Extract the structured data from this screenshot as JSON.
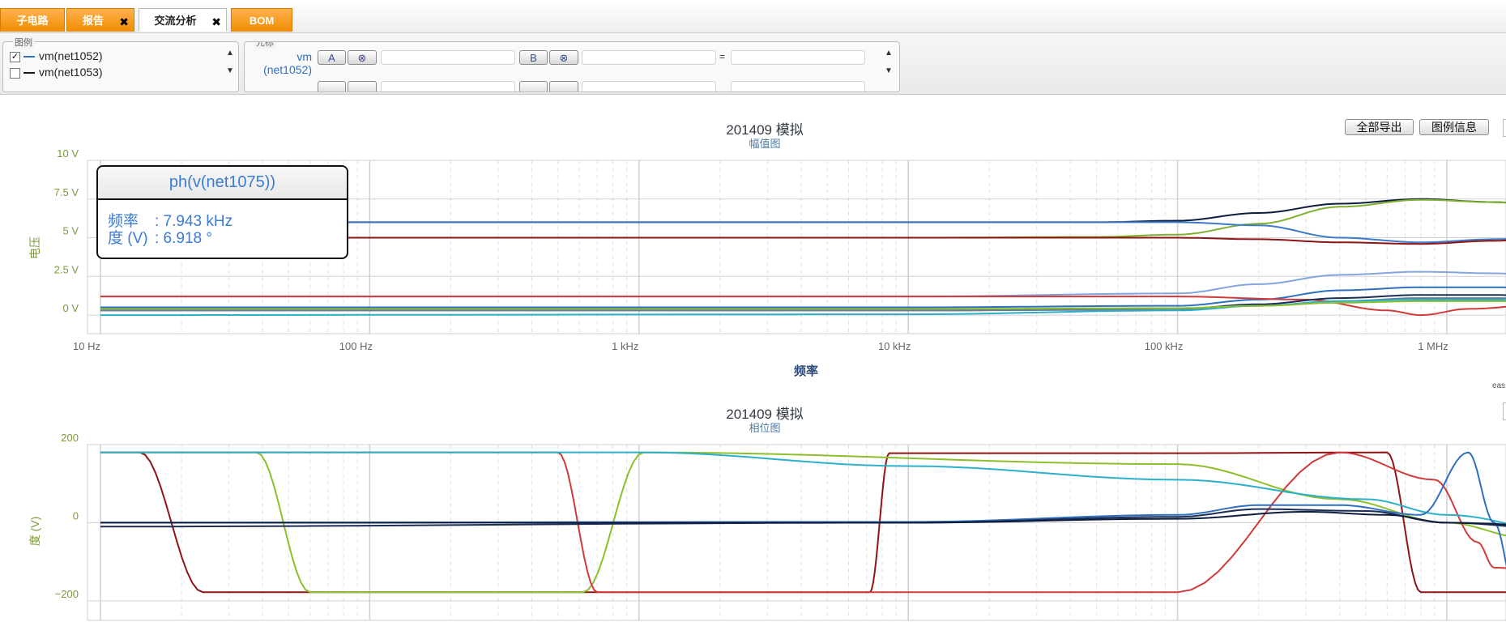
{
  "tabs": [
    {
      "label": "子电路",
      "closable": false
    },
    {
      "label": "报告",
      "closable": true
    },
    {
      "label": "交流分析",
      "closable": true
    },
    {
      "label": "BOM",
      "closable": false
    }
  ],
  "legend_panel": {
    "title": "图例",
    "items": [
      {
        "label": "vm(net1052)",
        "checked": true,
        "color": "#2f6fc0"
      },
      {
        "label": "vm(net1053)",
        "checked": false,
        "color": "#1a1a1a"
      }
    ]
  },
  "cursor_panel": {
    "title": "光标",
    "signal_line1": "vm",
    "signal_line2": "(net1052)",
    "btn_a": "A",
    "btn_b": "B",
    "equals": "="
  },
  "actions": {
    "export_all": "全部导出",
    "legend_info": "图例信息"
  },
  "magnitude_chart": {
    "title": "201409 模拟",
    "subtitle": "幅值图",
    "ylabel": "电压",
    "xlabel": "频率",
    "yticks": [
      "10 V",
      "7.5 V",
      "5 V",
      "2.5 V",
      "0 V"
    ],
    "xticks": [
      "10 Hz",
      "100 Hz",
      "1 kHz",
      "10 kHz",
      "100 kHz",
      "1 MHz"
    ]
  },
  "phase_chart": {
    "title": "201409 模拟",
    "subtitle": "相位图",
    "ylabel": "度 (V)",
    "yticks": [
      "200",
      "0",
      "−200"
    ]
  },
  "tooltip": {
    "title": "ph(v(net1075))",
    "line1_label": "频率",
    "line1_value": ": 7.943 kHz",
    "line2_label": "度 (V)",
    "line2_value": ": 6.918 °"
  },
  "corner_text": "eas",
  "chart_data": [
    {
      "type": "line",
      "title": "201409 模拟",
      "subtitle": "幅值图",
      "xlabel": "频率",
      "ylabel": "电压",
      "xscale": "log",
      "xlim": [
        10,
        3000000
      ],
      "ylim": [
        -1.2,
        10
      ],
      "series": [
        {
          "color": "#0d1d3d",
          "x": [
            10,
            10000,
            50000,
            100000,
            200000,
            400000,
            800000,
            1500000,
            3000000
          ],
          "y": [
            6.0,
            6.0,
            6.0,
            6.1,
            6.6,
            7.2,
            7.5,
            7.3,
            6.8
          ]
        },
        {
          "color": "#7fb02f",
          "x": [
            10,
            10000,
            50000,
            100000,
            200000,
            400000,
            800000,
            1500000,
            3000000
          ],
          "y": [
            5.0,
            5.0,
            5.05,
            5.2,
            5.9,
            7.0,
            7.45,
            7.3,
            6.7
          ]
        },
        {
          "color": "#3d7ac8",
          "x": [
            10,
            10000,
            100000,
            200000,
            400000,
            800000,
            1500000,
            3000000
          ],
          "y": [
            6.0,
            6.0,
            6.0,
            5.8,
            5.0,
            4.7,
            4.9,
            5.2
          ]
        },
        {
          "color": "#8f1515",
          "x": [
            10,
            10000,
            100000,
            200000,
            400000,
            800000,
            1500000,
            3000000
          ],
          "y": [
            5.0,
            5.0,
            5.0,
            4.9,
            4.7,
            4.6,
            4.8,
            5.2
          ]
        },
        {
          "color": "#84a6de",
          "x": [
            10,
            10000,
            100000,
            200000,
            400000,
            800000,
            1500000,
            3000000
          ],
          "y": [
            1.2,
            1.2,
            1.4,
            2.0,
            2.6,
            2.8,
            2.7,
            2.4
          ]
        },
        {
          "color": "#2f6fc0",
          "x": [
            10,
            10000,
            100000,
            200000,
            400000,
            800000,
            1500000,
            3000000
          ],
          "y": [
            0.5,
            0.5,
            0.6,
            1.0,
            1.6,
            1.8,
            1.8,
            1.6
          ]
        },
        {
          "color": "#d03a3a",
          "x": [
            10,
            10000,
            100000,
            300000,
            600000,
            800000,
            1200000,
            3000000
          ],
          "y": [
            1.2,
            1.2,
            1.2,
            1.0,
            0.3,
            0.0,
            0.4,
            0.9
          ]
        },
        {
          "color": "#1c2d55",
          "x": [
            10,
            10000,
            100000,
            200000,
            400000,
            800000,
            1500000,
            3000000
          ],
          "y": [
            0.3,
            0.3,
            0.4,
            0.7,
            1.1,
            1.3,
            1.3,
            1.1
          ]
        },
        {
          "color": "#6b7a9a",
          "x": [
            10,
            10000,
            100000,
            200000,
            400000,
            800000,
            1500000,
            3000000
          ],
          "y": [
            0.3,
            0.3,
            0.35,
            0.6,
            0.9,
            1.1,
            1.1,
            0.9
          ]
        },
        {
          "color": "#2ab0c9",
          "x": [
            10,
            10000,
            100000,
            200000,
            400000,
            800000,
            1500000,
            3000000
          ],
          "y": [
            0.0,
            0.05,
            0.3,
            0.6,
            0.9,
            1.0,
            1.0,
            0.9
          ]
        },
        {
          "color": "#8cbf2c",
          "x": [
            10,
            10000,
            100000,
            200000,
            400000,
            800000,
            1500000,
            3000000
          ],
          "y": [
            0.4,
            0.4,
            0.45,
            0.6,
            0.8,
            0.9,
            0.9,
            0.8
          ]
        }
      ]
    },
    {
      "type": "line",
      "title": "201409 模拟",
      "subtitle": "相位图",
      "ylabel": "度 (V)",
      "xscale": "log",
      "xlim": [
        10,
        3000000
      ],
      "ylim": [
        -250,
        200
      ],
      "series": [
        {
          "color": "#8f1515",
          "x": [
            10,
            14,
            24,
            7200,
            8500,
            100000,
            600000,
            800000,
            1500000,
            3000000
          ],
          "y": [
            180,
            180,
            -178,
            -178,
            178,
            178,
            180,
            -178,
            -178,
            -175
          ]
        },
        {
          "color": "#8cbf2c",
          "x": [
            10,
            38,
            60,
            620,
            1040,
            100000,
            400000,
            1000000,
            2000000,
            3000000
          ],
          "y": [
            180,
            180,
            -178,
            -178,
            180,
            150,
            60,
            0,
            -40,
            -70
          ]
        },
        {
          "color": "#d03a3a",
          "x": [
            10,
            500,
            700,
            100000,
            400000,
            900000,
            1300000,
            1500000,
            3000000
          ],
          "y": [
            180,
            180,
            -178,
            -178,
            180,
            110,
            -50,
            -115,
            -140
          ]
        },
        {
          "color": "#2ab0c9",
          "x": [
            10,
            1040,
            10000,
            100000,
            500000,
            1000000,
            3000000
          ],
          "y": [
            180,
            180,
            145,
            110,
            60,
            20,
            -30
          ]
        },
        {
          "color": "#2f6fc0",
          "x": [
            10,
            10000,
            100000,
            200000,
            400000,
            800000,
            1200000,
            1500000,
            1800000,
            3000000
          ],
          "y": [
            0,
            2,
            20,
            45,
            45,
            20,
            180,
            0,
            -180,
            -178
          ]
        },
        {
          "color": "#1c2d55",
          "x": [
            10,
            10000,
            100000,
            200000,
            500000,
            1000000,
            3000000
          ],
          "y": [
            -10,
            0,
            15,
            35,
            30,
            0,
            -20
          ]
        },
        {
          "color": "#0d1d3d",
          "x": [
            10,
            10000,
            100000,
            300000,
            600000,
            1000000,
            3000000
          ],
          "y": [
            0,
            0,
            10,
            28,
            20,
            0,
            -10
          ]
        }
      ]
    }
  ]
}
